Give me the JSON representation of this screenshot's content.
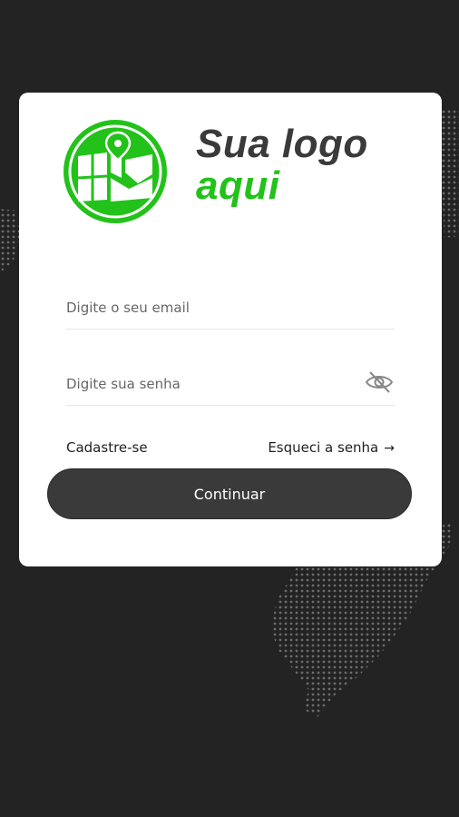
{
  "logo": {
    "line1": "Sua logo",
    "line2": "aqui",
    "brand_color": "#22c21a",
    "text_color": "#3a3a3a"
  },
  "login": {
    "email_placeholder": "Digite o seu email",
    "password_placeholder": "Digite sua senha",
    "password_toggle_icon": "eye-off-icon",
    "signup_label": "Cadastre-se",
    "forgot_label": "Esqueci a senha",
    "forgot_icon": "arrow-right-icon",
    "continue_label": "Continuar"
  },
  "colors": {
    "background": "#232323",
    "card": "#ffffff",
    "button": "#3a3a3a",
    "button_text": "#ffffff"
  }
}
